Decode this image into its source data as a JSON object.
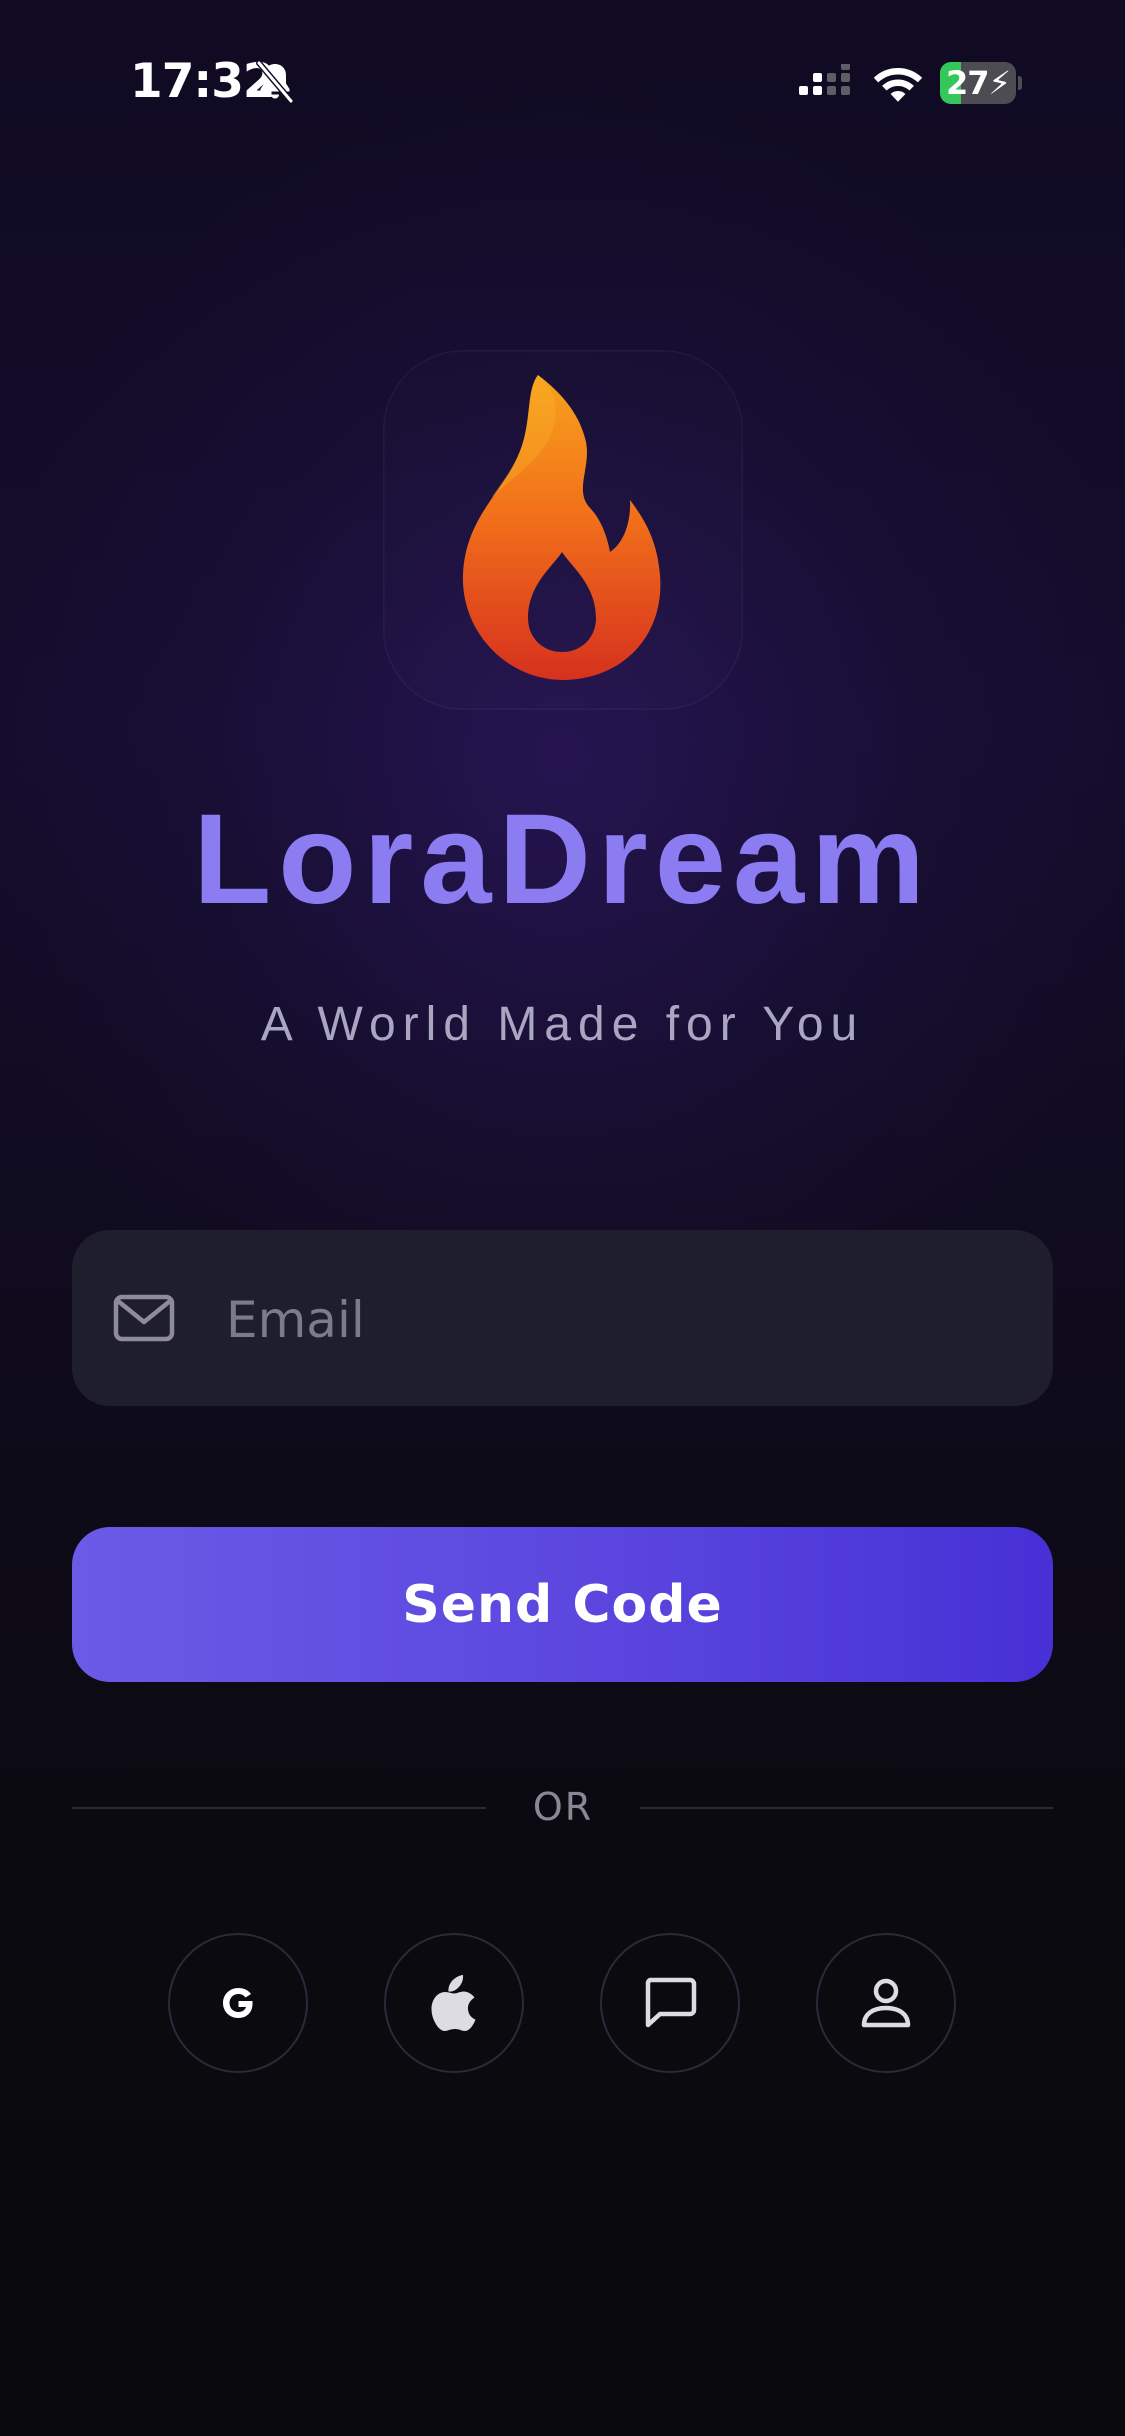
{
  "status_bar": {
    "time": "17:32",
    "battery_level": "27",
    "battery_fill_fraction": 0.27,
    "icons": [
      "bell-slash-icon",
      "cellular-signal-icon",
      "wifi-icon",
      "battery-charging-icon"
    ]
  },
  "brand": {
    "logo_icon": "flame-icon",
    "app_name": "LoraDream",
    "tagline": "A World Made for You",
    "title_color": "#8b7cf2"
  },
  "login": {
    "email_placeholder": "Email",
    "email_value": "",
    "email_icon": "mail-icon",
    "send_code_label": "Send Code",
    "button_color_start": "#6b5ae6",
    "button_color_end": "#4630d6",
    "or_label": "OR"
  },
  "social": [
    {
      "name": "google",
      "icon": "google-icon"
    },
    {
      "name": "apple",
      "icon": "apple-icon"
    },
    {
      "name": "message",
      "icon": "message-icon"
    },
    {
      "name": "guest",
      "icon": "person-icon"
    }
  ],
  "colors": {
    "background": "#0c0a14",
    "field_background": "#1f1e2c",
    "battery_green": "#34c759"
  }
}
